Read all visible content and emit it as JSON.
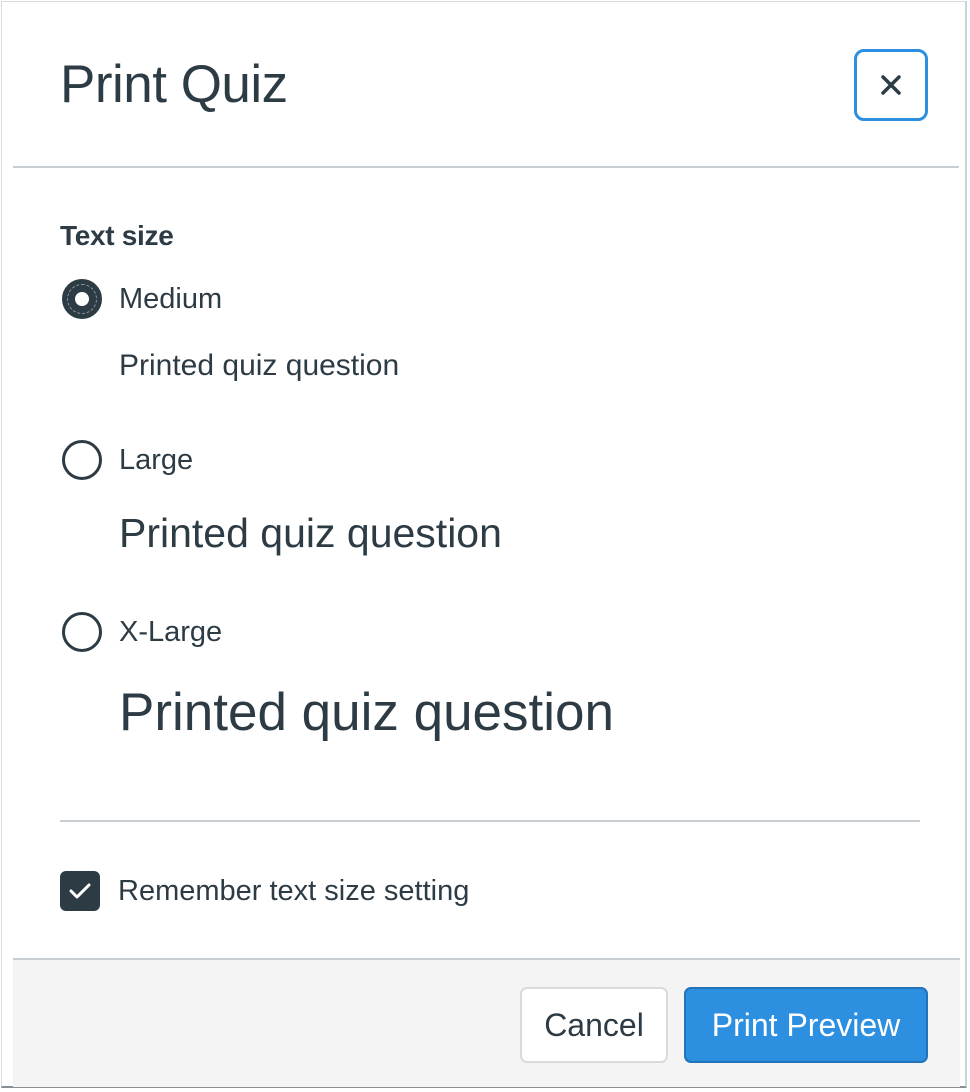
{
  "dialog": {
    "title": "Print Quiz",
    "close_icon": "close-icon",
    "accent_color": "#2d8fe0",
    "text_color": "#2d3b45"
  },
  "text_size": {
    "label": "Text size",
    "selected": "Medium",
    "options": [
      {
        "label": "Medium",
        "checked": true,
        "sample": "Printed quiz question"
      },
      {
        "label": "Large",
        "checked": false,
        "sample": "Printed quiz question"
      },
      {
        "label": "X-Large",
        "checked": false,
        "sample": "Printed quiz question"
      }
    ]
  },
  "remember": {
    "label": "Remember text size setting",
    "checked": true,
    "icon": "checkmark-icon"
  },
  "footer": {
    "cancel_label": "Cancel",
    "primary_label": "Print Preview"
  }
}
